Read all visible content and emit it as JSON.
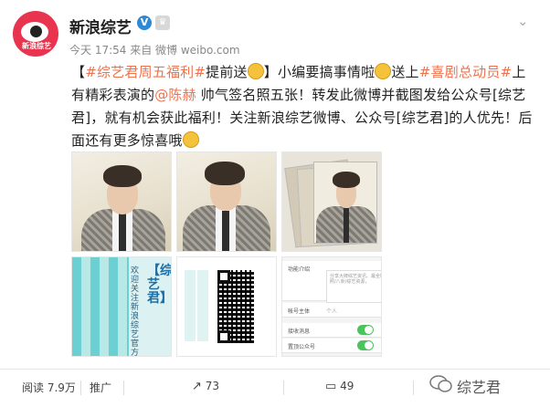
{
  "header": {
    "account_name": "新浪综艺",
    "avatar_text": "新浪综艺",
    "verified_icon": "verified-v-icon",
    "level_icon": "member-level-icon",
    "meta": "今天 17:54 来自 微博 weibo.com",
    "menu_icon": "chevron-down-icon"
  },
  "post": {
    "tag_open": "【",
    "tag1": "#综艺君周五福利#",
    "text1": "提前送",
    "text2": "】小编要搞事情啦",
    "text3": "送上",
    "tag2": "#喜剧总动员#",
    "text4": "上有精彩表演的",
    "mention": "@陈赫",
    "text5": " 帅气签名照五张！转发此微博并截图发给公众号[综艺君]，就有机会获此福利！关注新浪综艺微博、公众号[综艺君]的人优先！后面还有更多惊喜哦"
  },
  "images": {
    "qr_vertical_text": "欢迎关注新浪综艺官方微信",
    "qr_brand": "【综艺君】",
    "settings_rows": [
      "功能介绍",
      "帐号主体",
      "接收消息",
      "置顶公众号"
    ],
    "settings_signature": "分享大牌综艺资讯、最全剧照/八卦/综艺资源，",
    "settings_owner": "个人"
  },
  "footer": {
    "reads": "阅读 7.9万",
    "promote": "推广",
    "share_count": "73",
    "comment_count": "49",
    "like_count": "",
    "watermark": "综艺君"
  }
}
